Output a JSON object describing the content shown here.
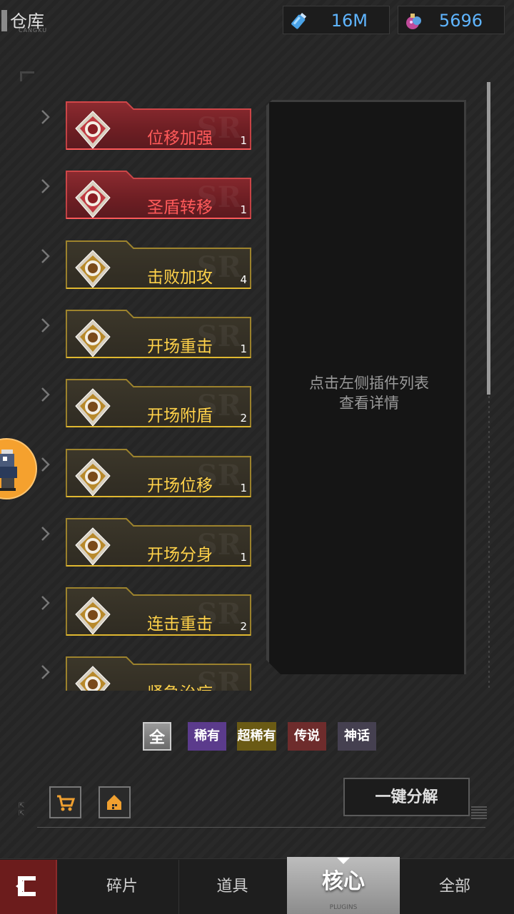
{
  "header": {
    "title": "仓库",
    "subtitle": "CANGKU",
    "resources": [
      {
        "icon": "bottle-icon",
        "value": "16M"
      },
      {
        "icon": "potion-icon",
        "value": "5696"
      }
    ]
  },
  "plugins": [
    {
      "name": "位移加强",
      "count": "1",
      "rarity": "legend",
      "icon": "running-man-badge-icon"
    },
    {
      "name": "圣盾转移",
      "count": "1",
      "rarity": "legend",
      "icon": "shield-badge-icon"
    },
    {
      "name": "击败加攻",
      "count": "4",
      "rarity": "super",
      "icon": "sword-badge-icon"
    },
    {
      "name": "开场重击",
      "count": "1",
      "rarity": "super",
      "icon": "heavy-hit-badge-icon"
    },
    {
      "name": "开场附盾",
      "count": "2",
      "rarity": "super",
      "icon": "shield-badge-icon"
    },
    {
      "name": "开场位移",
      "count": "1",
      "rarity": "super",
      "icon": "running-man-badge-icon"
    },
    {
      "name": "开场分身",
      "count": "1",
      "rarity": "super",
      "icon": "clone-badge-icon"
    },
    {
      "name": "连击重击",
      "count": "2",
      "rarity": "super",
      "icon": "combo-badge-icon"
    },
    {
      "name": "紧急治疗",
      "count": "",
      "rarity": "super",
      "icon": "heal-badge-icon"
    }
  ],
  "detail": {
    "line1": "点击左侧插件列表",
    "line2": "查看详情"
  },
  "filters": {
    "all": "全",
    "rare": "稀有",
    "super": "超稀有",
    "legend": "传说",
    "myth": "神话"
  },
  "actions": {
    "decompose": "一键分解"
  },
  "tabs": {
    "fragments": "碎片",
    "items": "道具",
    "core": "核心",
    "core_sub": "PLUGINS",
    "all": "全部"
  },
  "colors": {
    "legend_text": "#ff5a5a",
    "super_text": "#ffd24a",
    "resource_text": "#5fb5ff"
  }
}
